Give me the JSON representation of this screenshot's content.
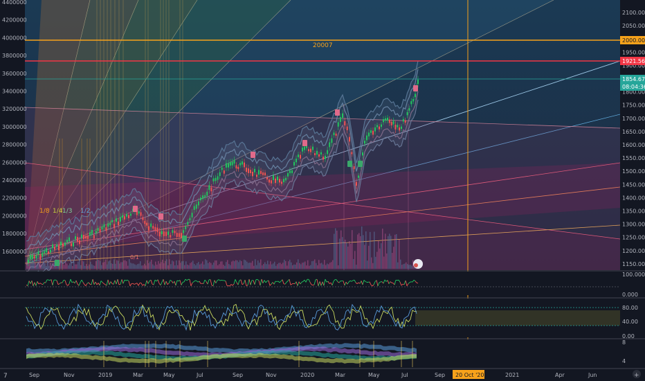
{
  "theme": {
    "bg": "#131722",
    "pane_bg": "#1e3347",
    "grid": "#2a2e39",
    "axis_text": "#b2b5be",
    "bull": "#22c55e",
    "bear": "#ef5350",
    "orange": "#f7a21b",
    "red_line": "#f23645",
    "teal": "#26a69a",
    "separator": "#434651"
  },
  "price_axis_left": {
    "ticks": [
      "4400000",
      "4200000",
      "4000000",
      "3800000",
      "3600000",
      "3400000",
      "3200000",
      "3000000",
      "2800000",
      "2600000",
      "2400000",
      "2200000",
      "2000000",
      "1800000",
      "1600000"
    ]
  },
  "price_axis_right": {
    "ticks": [
      "2100.000",
      "2050.000",
      "2000.000",
      "1950.000",
      "1900.000",
      "1850.000",
      "1800.000",
      "1750.000",
      "1700.000",
      "1650.000",
      "1600.000",
      "1550.000",
      "1500.000",
      "1450.000",
      "1400.000",
      "1350.000",
      "1300.000",
      "1250.000",
      "1200.000",
      "1150.000"
    ]
  },
  "price_labels": {
    "orange_line": "2000.000",
    "red_line": "1921.568",
    "last_price": "1854.678",
    "countdown": "08:04:36"
  },
  "annotations": {
    "level_text": "20007",
    "fan_labels": [
      "1/8",
      "1/4",
      "1/3",
      "1/2"
    ],
    "small_label": "0/1"
  },
  "indicators": {
    "osc1_ticks": [
      "100.000",
      "0.000"
    ],
    "osc2_ticks": [
      "80.00",
      "40.00",
      "0.00"
    ],
    "osc3_ticks": [
      "8",
      "4"
    ]
  },
  "time_axis": {
    "labels": [
      "Sep",
      "Nov",
      "2019",
      "Mar",
      "May",
      "Jul",
      "Sep",
      "Nov",
      "2020",
      "Mar",
      "May",
      "Jul",
      "Sep",
      "2021",
      "Apr",
      "Jun"
    ],
    "crosshair_label": "20 Oct '20",
    "corner_left": "7",
    "corner_right": "+"
  }
}
